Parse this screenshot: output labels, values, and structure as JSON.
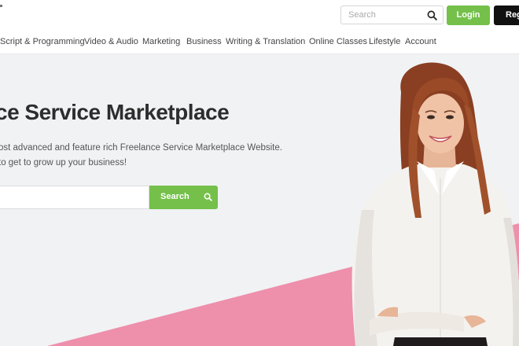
{
  "header": {
    "search_placeholder": "Search",
    "search_icon": "search-icon",
    "login_label": "Login",
    "register_label": "Register"
  },
  "nav": {
    "items": [
      "Script & Programming",
      "Video & Audio",
      "Marketing",
      "Business",
      "Writing & Translation",
      "Online Classes",
      "Lifestyle",
      "Account"
    ]
  },
  "hero": {
    "title": "ce Service Marketplace",
    "subtitle_line1": "ost advanced and feature rich Freelance Service Marketplace Website.",
    "subtitle_line2": "to get to grow up your business!",
    "search_value": "",
    "search_button_label": "Search",
    "search_button_icon": "search-icon"
  },
  "colors": {
    "accent_green": "#74c04a",
    "dark_button": "#111111",
    "hero_background": "#f1f2f4",
    "pink_band": "#ee8fac"
  }
}
